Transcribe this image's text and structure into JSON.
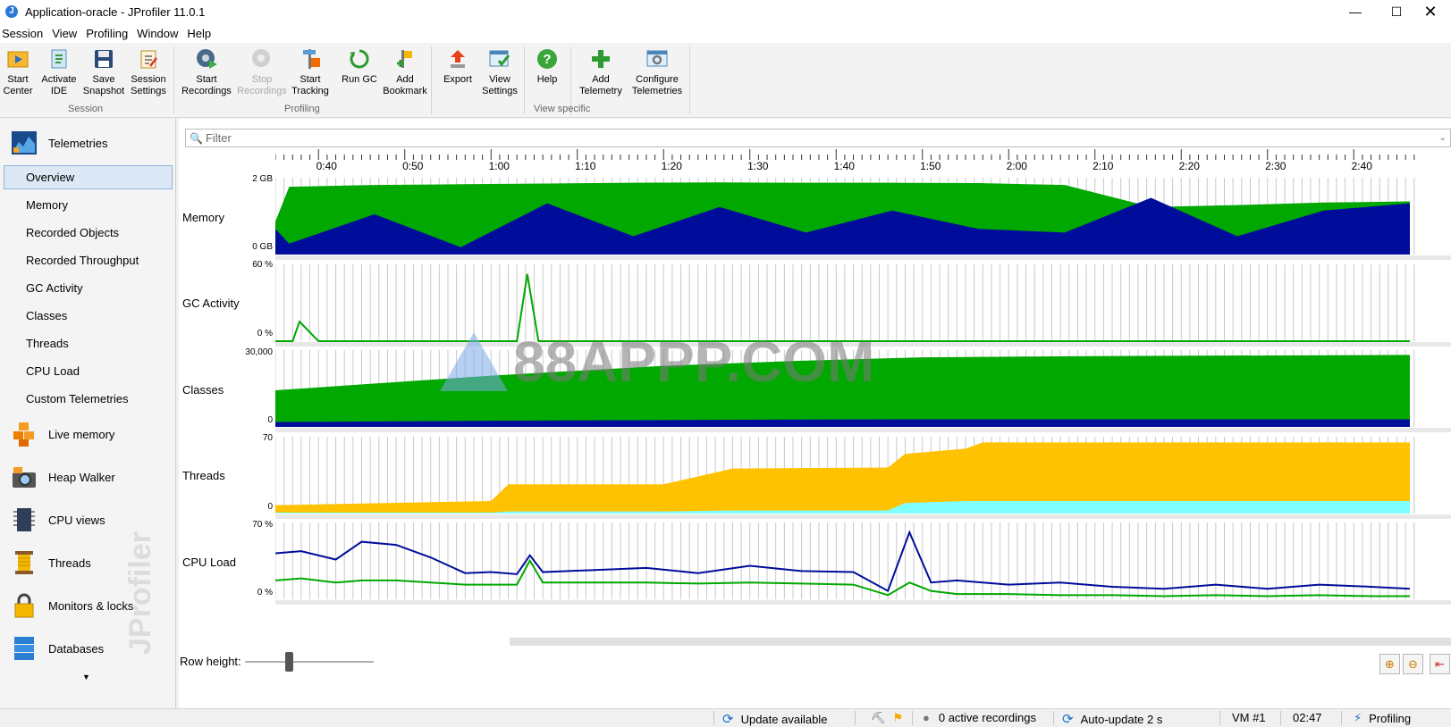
{
  "window": {
    "title": "Application-oracle - JProfiler 11.0.1"
  },
  "menu": [
    "Session",
    "View",
    "Profiling",
    "Window",
    "Help"
  ],
  "toolbar": {
    "session": {
      "label": "Session",
      "buttons": [
        {
          "line1": "Start",
          "line2": "Center"
        },
        {
          "line1": "Activate",
          "line2": "IDE"
        },
        {
          "line1": "Save",
          "line2": "Snapshot"
        },
        {
          "line1": "Session",
          "line2": "Settings"
        }
      ]
    },
    "profiling": {
      "label": "Profiling",
      "buttons": [
        {
          "line1": "Start",
          "line2": "Recordings"
        },
        {
          "line1": "Stop",
          "line2": "Recordings"
        },
        {
          "line1": "Start",
          "line2": "Tracking"
        },
        {
          "line1": "Run GC",
          "line2": ""
        },
        {
          "line1": "Add",
          "line2": "Bookmark"
        }
      ]
    },
    "view_specific": {
      "label": "View specific",
      "buttons": [
        {
          "line1": "Export",
          "line2": ""
        },
        {
          "line1": "View",
          "line2": "Settings"
        },
        {
          "line1": "Help",
          "line2": ""
        },
        {
          "line1": "Add",
          "line2": "Telemetry"
        },
        {
          "line1": "Configure",
          "line2": "Telemetries"
        }
      ]
    }
  },
  "sidebar": {
    "telemetries": "Telemetries",
    "sub_items": [
      "Overview",
      "Memory",
      "Recorded Objects",
      "Recorded Throughput",
      "GC Activity",
      "Classes",
      "Threads",
      "CPU Load",
      "Custom Telemetries"
    ],
    "sections": [
      "Live memory",
      "Heap Walker",
      "CPU views",
      "Threads",
      "Monitors & locks",
      "Databases"
    ],
    "brand": "JProfiler"
  },
  "filter": {
    "placeholder": "Filter"
  },
  "time_axis": {
    "ticks": [
      "0:40",
      "0:50",
      "1:00",
      "1:10",
      "1:20",
      "1:30",
      "1:40",
      "1:50",
      "2:00",
      "2:10",
      "2:20",
      "2:30",
      "2:40"
    ]
  },
  "rows": [
    {
      "name": "Memory",
      "max": "2 GB",
      "min": "0 GB"
    },
    {
      "name": "GC Activity",
      "max": "60 %",
      "min": "0 %"
    },
    {
      "name": "Classes",
      "max": "30,000",
      "min": "0"
    },
    {
      "name": "Threads",
      "max": "70",
      "min": "0"
    },
    {
      "name": "CPU Load",
      "max": "70 %",
      "min": "0 %"
    }
  ],
  "row_height": {
    "label": "Row height:"
  },
  "watermark": "88APPP.COM",
  "status": {
    "update": "Update available",
    "recordings": "0 active recordings",
    "autoupdate": "Auto-update 2 s",
    "vm": "VM #1",
    "time": "02:47",
    "mode": "Profiling"
  },
  "colors": {
    "memory_used": "#000c9a",
    "memory_free": "#00a800",
    "gc": "#00a800",
    "threads_waiting": "#ffc200",
    "threads_running": "#7fffff",
    "cpu_process": "#000c9a",
    "cpu_gc": "#00a800"
  },
  "chart_data": [
    {
      "type": "area",
      "name": "Memory",
      "x": [
        35.0,
        36.6,
        46.5,
        56.5,
        66.5,
        76.5,
        86.5,
        96.5,
        106.5,
        116.5,
        126.5,
        136.5,
        146.5,
        156.5,
        166.5
      ],
      "series": [
        {
          "values": [
            0.9,
            1.85,
            1.9,
            1.92,
            1.94,
            1.96,
            1.97,
            1.96,
            1.96,
            1.95,
            1.9,
            1.3,
            1.35,
            1.42,
            1.45
          ]
        },
        {
          "values": [
            0.7,
            0.3,
            1.1,
            0.2,
            1.4,
            0.5,
            1.3,
            0.6,
            1.2,
            0.7,
            0.6,
            1.55,
            0.5,
            1.2,
            1.4
          ]
        }
      ],
      "ylim": [
        0,
        2
      ]
    },
    {
      "type": "line",
      "name": "GC Activity",
      "x": [
        35.0,
        37.0,
        37.8,
        40,
        50,
        60,
        63,
        64.2,
        65.5,
        70,
        80,
        90,
        100,
        106,
        166.5
      ],
      "values": [
        0,
        0,
        16,
        0,
        0,
        0,
        0,
        55,
        0,
        0,
        0,
        0,
        0,
        0,
        0
      ],
      "ylim": [
        0,
        60
      ]
    },
    {
      "type": "area",
      "name": "Classes",
      "x": [
        35.0,
        60,
        80,
        95,
        110,
        130,
        166.5
      ],
      "series": [
        {
          "values": [
            15000,
            21000,
            25000,
            27000,
            28500,
            29000,
            29500
          ]
        },
        {
          "values": [
            2000,
            2500,
            2800,
            3000,
            3100,
            3100,
            3100
          ]
        }
      ],
      "ylim": [
        0,
        30000
      ]
    },
    {
      "type": "area",
      "name": "Threads",
      "x": [
        35.0,
        60,
        62,
        80,
        88,
        106,
        108,
        115,
        117,
        135,
        166.5
      ],
      "series": [
        {
          "values": [
            8,
            12,
            28,
            28,
            43,
            44,
            57,
            62,
            68,
            68,
            68
          ]
        },
        {
          "values": [
            1,
            1,
            2,
            2,
            3,
            3,
            10,
            12,
            12,
            12,
            12
          ]
        }
      ],
      "ylim": [
        0,
        70
      ]
    },
    {
      "type": "line",
      "name": "CPU Load",
      "x": [
        35,
        38,
        42,
        45,
        49,
        53,
        57,
        60,
        63,
        64.5,
        66,
        72,
        78,
        84,
        90,
        96,
        102,
        106,
        108.5,
        111,
        114,
        120,
        126,
        132,
        138,
        144,
        150,
        156,
        162,
        166.5
      ],
      "series": [
        {
          "values": [
            44,
            46,
            38,
            55,
            52,
            40,
            25,
            26,
            24,
            42,
            26,
            28,
            30,
            25,
            32,
            27,
            26,
            8,
            64,
            16,
            18,
            14,
            16,
            12,
            10,
            14,
            10,
            14,
            12,
            10
          ]
        },
        {
          "values": [
            18,
            20,
            16,
            18,
            18,
            16,
            14,
            14,
            14,
            37,
            16,
            16,
            16,
            15,
            16,
            15,
            14,
            4,
            16,
            8,
            5,
            5,
            4,
            4,
            3,
            4,
            3,
            4,
            3,
            3
          ]
        }
      ],
      "ylim": [
        0,
        70
      ]
    }
  ]
}
